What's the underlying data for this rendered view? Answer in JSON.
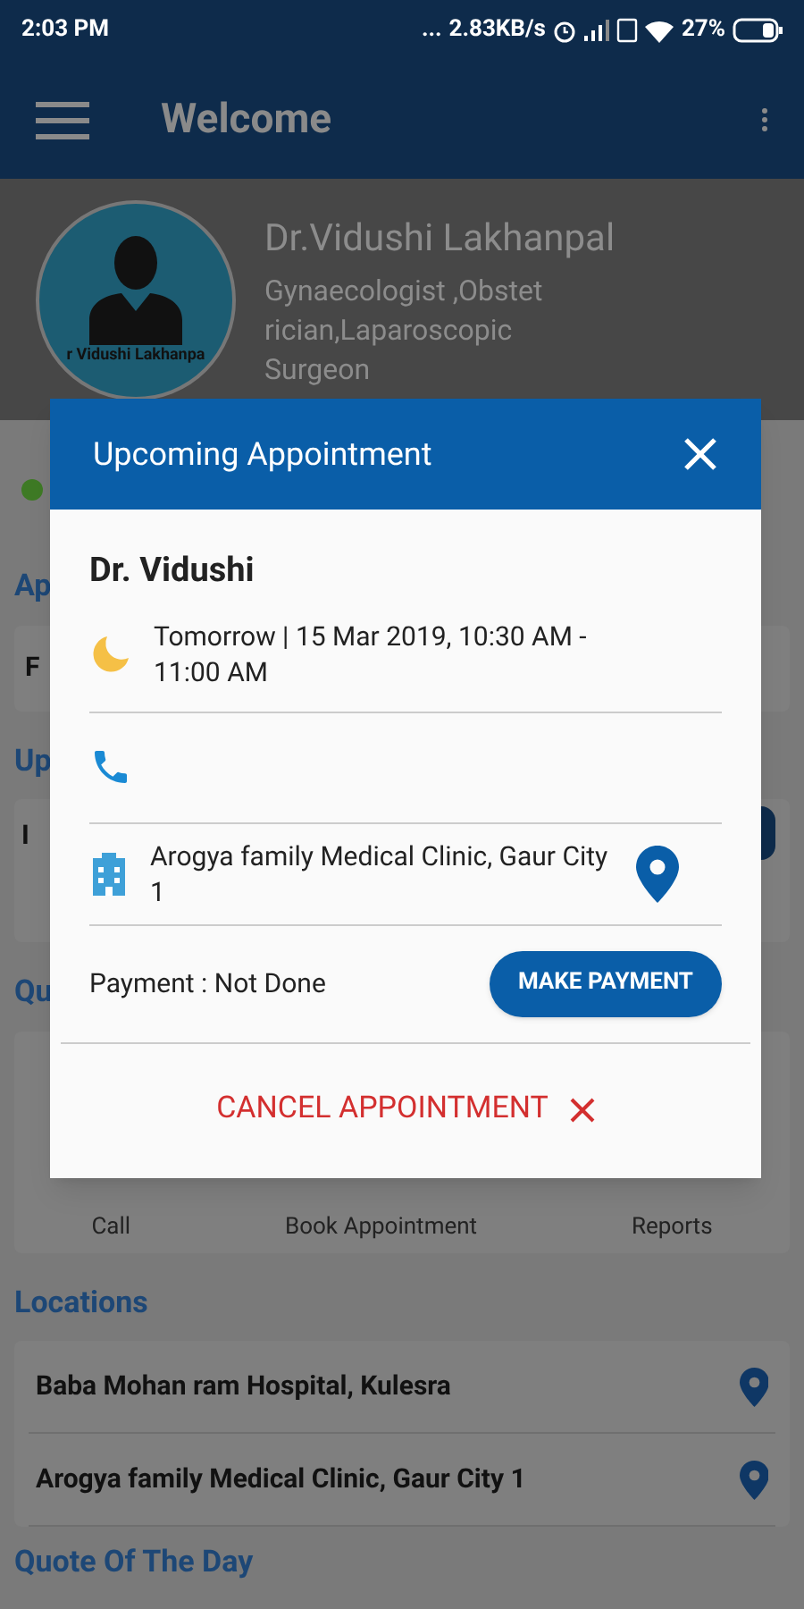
{
  "status_bar": {
    "time": "2:03 PM",
    "dots": "...",
    "network_speed": "2.83KB/s",
    "battery": "27%"
  },
  "app_bar": {
    "title": "Welcome"
  },
  "profile": {
    "name": "Dr.Vidushi Lakhanpal",
    "specialty_lines": [
      "Gynaecologist ,Obstet",
      "rician,Laparoscopic",
      "Surgeon"
    ],
    "avatar_caption": "r Vidushi Lakhanpa"
  },
  "background": {
    "appointment_heading": "Ap",
    "appointment_card_text": "F",
    "upcoming_heading": "Up",
    "upcoming_card_text": "I",
    "quick_heading": "Qu",
    "quick_actions": [
      "Call",
      "Book Appointment",
      "Reports"
    ]
  },
  "locations": {
    "heading": "Locations",
    "items": [
      "Baba Mohan ram Hospital, Kulesra",
      "Arogya family Medical Clinic, Gaur City 1"
    ]
  },
  "quote_heading": "Quote Of The Day",
  "dialog": {
    "title": "Upcoming Appointment",
    "doctor": "Dr. Vidushi",
    "time": "Tomorrow | 15 Mar 2019, 10:30 AM - 11:00 AM",
    "location": "Arogya family Medical Clinic, Gaur City 1",
    "payment_status": "Payment : Not Done",
    "pay_button": "MAKE PAYMENT",
    "cancel_button": "CANCEL APPOINTMENT"
  }
}
